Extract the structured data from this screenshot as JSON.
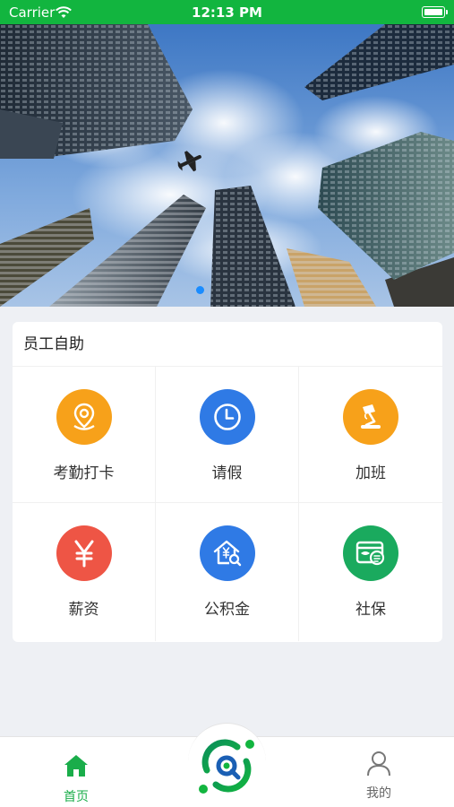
{
  "status_bar": {
    "carrier": "Carrier",
    "time": "12:13 PM"
  },
  "banner": {
    "slide_count": 1,
    "active_index": 0,
    "active_color": "#1a8cff"
  },
  "self_service": {
    "title": "员工自助",
    "items": [
      {
        "label": "考勤打卡",
        "icon": "location-pin-icon",
        "color": "#f7a11a"
      },
      {
        "label": "请假",
        "icon": "clock-icon",
        "color": "#2f7ae5"
      },
      {
        "label": "加班",
        "icon": "desk-lamp-icon",
        "color": "#f7a11a"
      },
      {
        "label": "薪资",
        "icon": "yen-icon",
        "color": "#ee5545"
      },
      {
        "label": "公积金",
        "icon": "house-yen-icon",
        "color": "#2f7ae5"
      },
      {
        "label": "社保",
        "icon": "social-security-card-icon",
        "color": "#1aaa5e"
      }
    ]
  },
  "tab_bar": {
    "home_label": "首页",
    "mine_label": "我的",
    "active_color": "#1aad4a"
  }
}
